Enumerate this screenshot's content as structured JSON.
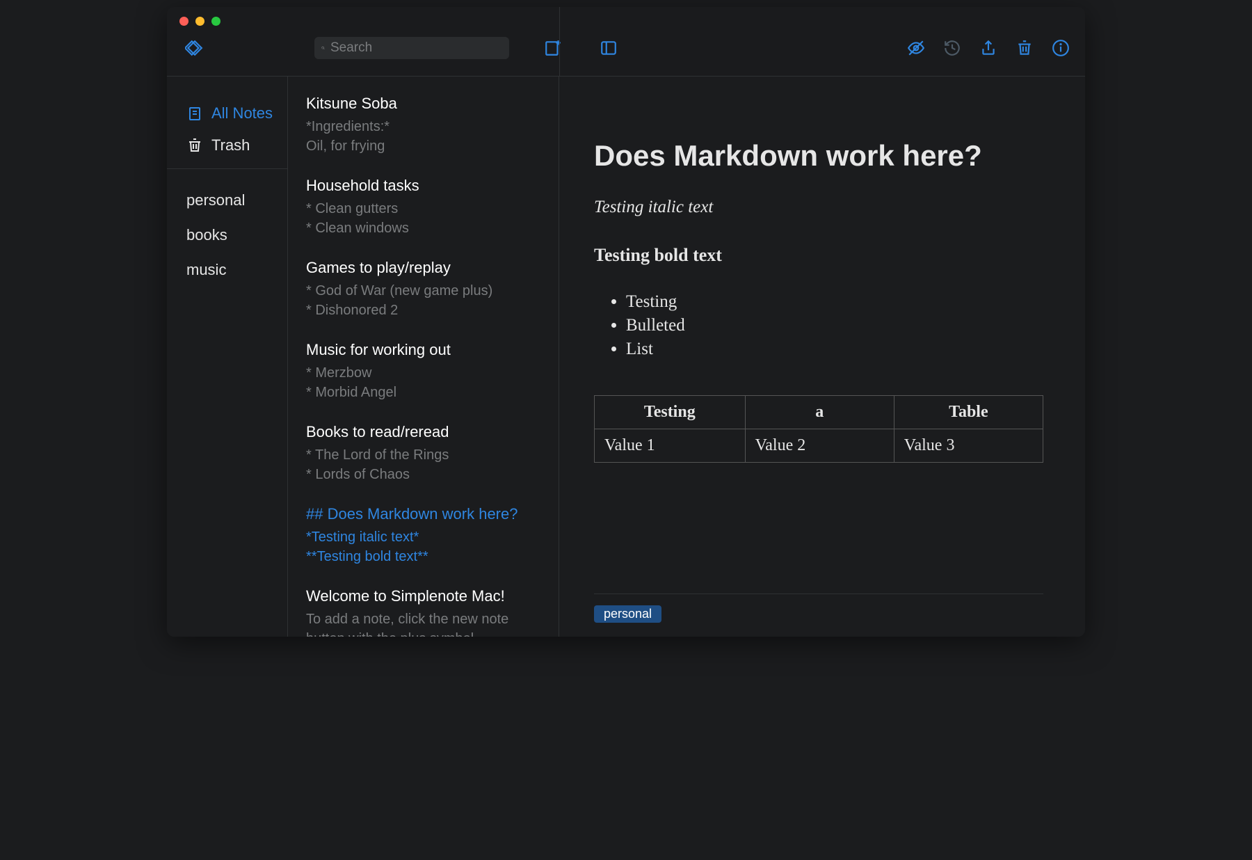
{
  "search": {
    "placeholder": "Search"
  },
  "sidebar": {
    "all_notes": "All Notes",
    "trash": "Trash",
    "tags": [
      "personal",
      "books",
      "music"
    ]
  },
  "notes": [
    {
      "title": "Kitsune Soba",
      "preview": "*Ingredients:*\nOil, for frying",
      "selected": false
    },
    {
      "title": "Household tasks",
      "preview": "* Clean gutters\n* Clean windows",
      "selected": false
    },
    {
      "title": "Games to play/replay",
      "preview": "* God of War (new game plus)\n* Dishonored 2",
      "selected": false
    },
    {
      "title": "Music for working out",
      "preview": "* Merzbow\n* Morbid Angel",
      "selected": false
    },
    {
      "title": "Books to read/reread",
      "preview": "* The Lord of the Rings\n* Lords of Chaos",
      "selected": false
    },
    {
      "title": "## Does Markdown work here?",
      "preview": "*Testing italic text*\n**Testing bold text**",
      "selected": true
    },
    {
      "title": "Welcome to Simplenote Mac!",
      "preview": "To add a note, click the new note button with the plus symbol.",
      "selected": false
    }
  ],
  "editor": {
    "heading": "Does Markdown work here?",
    "italic": "Testing italic text",
    "bold": "Testing bold text",
    "bullets": [
      "Testing",
      "Bulleted",
      "List"
    ],
    "table": {
      "headers": [
        "Testing",
        "a",
        "Table"
      ],
      "row": [
        "Value 1",
        "Value 2",
        "Value 3"
      ]
    },
    "tag": "personal"
  }
}
